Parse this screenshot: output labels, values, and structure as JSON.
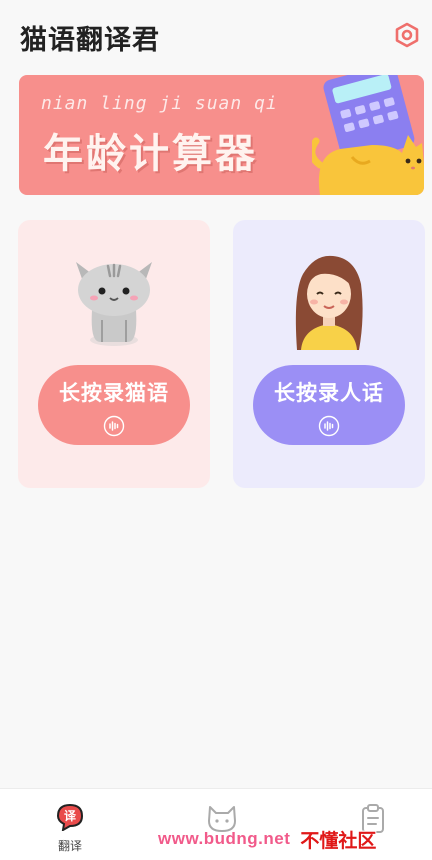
{
  "header": {
    "title": "猫语翻译君",
    "settings_icon": "hexagon-settings-icon"
  },
  "banner": {
    "pinyin": "nian ling ji suan qi",
    "title": "年龄计算器",
    "bg_color": "#f78f8c"
  },
  "cards": [
    {
      "label": "长按录猫语",
      "accent": "#f78f8c",
      "bg": "#fdeaea",
      "icon": "cat-icon"
    },
    {
      "label": "长按录人话",
      "accent": "#9b8ff5",
      "bg": "#ecebfc",
      "icon": "girl-icon"
    }
  ],
  "tabbar": {
    "items": [
      {
        "label": "翻译",
        "icon": "translate-icon",
        "active": true
      },
      {
        "label": "",
        "icon": "cat-face-icon",
        "active": false
      },
      {
        "label": "",
        "icon": "clipboard-icon",
        "active": false
      }
    ]
  },
  "watermark": {
    "url": "www.budng.net",
    "name": "不懂社区"
  }
}
